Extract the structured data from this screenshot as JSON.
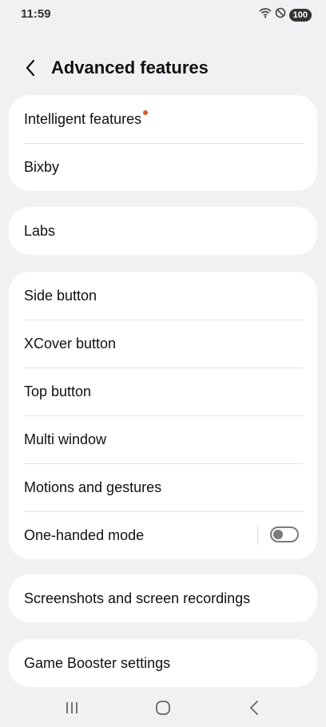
{
  "status_bar": {
    "time": "11:59",
    "battery": "100",
    "icons": [
      "wifi-icon",
      "do-not-disturb-icon"
    ]
  },
  "header": {
    "title": "Advanced features",
    "back_icon": "chevron-left-icon"
  },
  "cards": [
    {
      "items": [
        {
          "label": "Intelligent features",
          "badge": "new-dot"
        },
        {
          "label": "Bixby"
        }
      ]
    },
    {
      "items": [
        {
          "label": "Labs"
        }
      ]
    },
    {
      "items": [
        {
          "label": "Side button"
        },
        {
          "label": "XCover button"
        },
        {
          "label": "Top button"
        },
        {
          "label": "Multi window"
        },
        {
          "label": "Motions and gestures"
        },
        {
          "label": "One-handed mode",
          "toggle": false
        }
      ]
    },
    {
      "items": [
        {
          "label": "Screenshots and screen recordings"
        }
      ]
    },
    {
      "items": [
        {
          "label": "Game Booster settings"
        }
      ]
    }
  ],
  "nav_bar": {
    "icons": [
      "recents-icon",
      "home-icon",
      "back-icon"
    ]
  },
  "colors": {
    "background": "#f1f1f3",
    "card": "#ffffff",
    "badge": "#e0562e",
    "toggle_off": "#7c7c80"
  }
}
